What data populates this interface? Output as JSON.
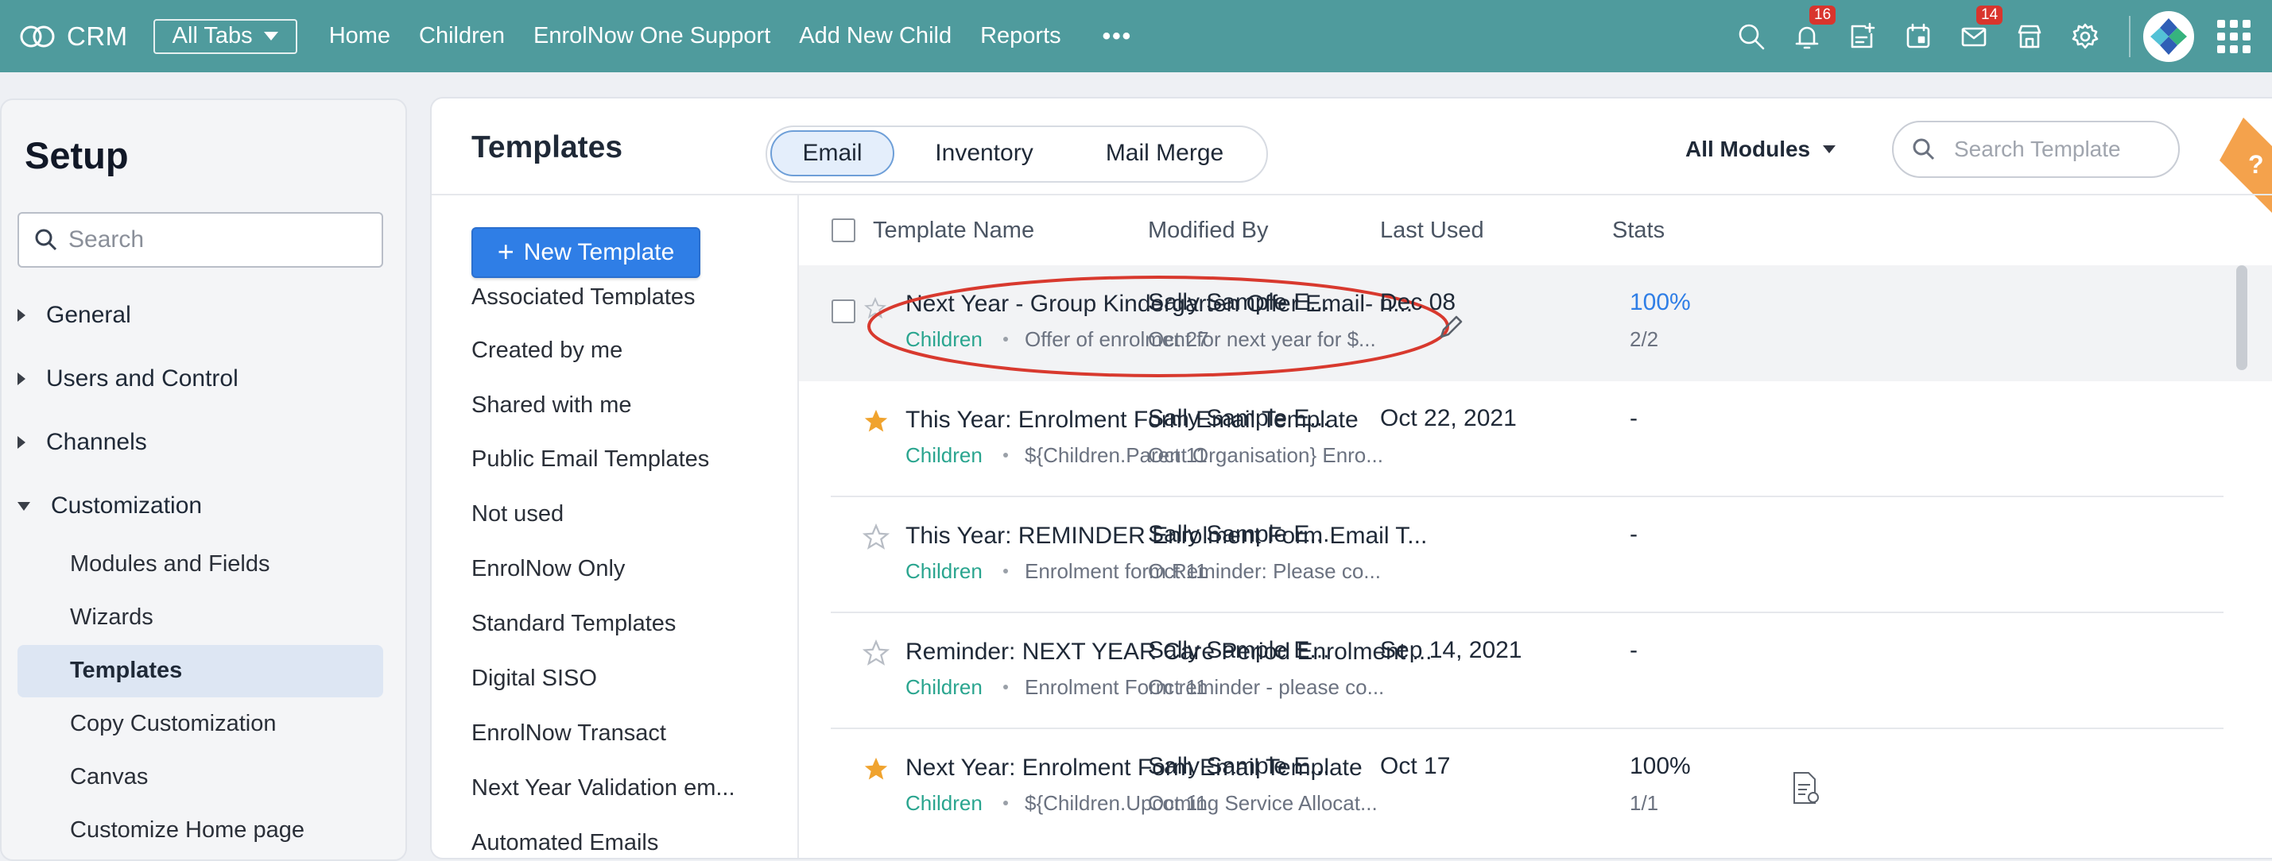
{
  "topbar": {
    "app_name": "CRM",
    "all_tabs_label": "All Tabs",
    "nav_items": [
      "Home",
      "Children",
      "EnrolNow One Support",
      "Add New Child",
      "Reports"
    ],
    "more_label": "•••",
    "icons": [
      "search-icon",
      "bell-icon",
      "add-note-icon",
      "calendar-icon",
      "mail-icon",
      "store-icon",
      "gear-icon"
    ],
    "badges": {
      "notifications": "16",
      "mail": "14"
    },
    "bar_color": "#4f9b9d"
  },
  "setup": {
    "title": "Setup",
    "search_placeholder": "Search",
    "sections": [
      {
        "label": "General",
        "expanded": false
      },
      {
        "label": "Users and Control",
        "expanded": false
      },
      {
        "label": "Channels",
        "expanded": false
      },
      {
        "label": "Customization",
        "expanded": true
      }
    ],
    "customization_items": [
      "Modules and Fields",
      "Wizards",
      "Templates",
      "Copy Customization",
      "Canvas",
      "Customize Home page"
    ],
    "active_item": "Templates"
  },
  "templates": {
    "title": "Templates",
    "tabs": [
      "Email",
      "Inventory",
      "Mail Merge"
    ],
    "active_tab": "Email",
    "module_filter": "All Modules",
    "search_placeholder": "Search Template",
    "help_label": "?",
    "new_template_label": "New Template",
    "filters": [
      "Associated Templates",
      "Created by me",
      "Shared with me",
      "Public Email Templates",
      "Not used",
      "EnrolNow Only",
      "Standard Templates",
      "Digital SISO",
      "EnrolNow Transact",
      "Next Year Validation em...",
      "Automated Emails"
    ],
    "columns": {
      "name": "Template Name",
      "modified_by": "Modified By",
      "last_used": "Last Used",
      "stats": "Stats"
    },
    "rows": [
      {
        "name": "Next Year - Group Kindergarten Offer Email- n...",
        "module": "Children",
        "desc": "Offer of enrolment for next year for $...",
        "modified_by": "Sally Sample E...",
        "modified_date": "Oct 27",
        "last_used": "Dec 08",
        "stat": "100%",
        "stat_sub": "2/2",
        "starred": false
      },
      {
        "name": "This Year: Enrolment Form Email Template",
        "module": "Children",
        "desc": "${Children.Parent Organisation} Enro...",
        "modified_by": "Sally Sample E...",
        "modified_date": "Oct 11",
        "last_used": "Oct 22, 2021",
        "stat": "-",
        "stat_sub": "",
        "starred": true
      },
      {
        "name": "This Year: REMINDER Enrolment Form Email T...",
        "module": "Children",
        "desc": "Enrolment form Reminder: Please co...",
        "modified_by": "Sally Sample E...",
        "modified_date": "Oct 11",
        "last_used": "",
        "stat": "-",
        "stat_sub": "",
        "starred": false
      },
      {
        "name": "Reminder: NEXT YEAR Care Period Enrolment ...",
        "module": "Children",
        "desc": "Enrolment Form reminder - please co...",
        "modified_by": "Sally Sample E...",
        "modified_date": "Oct 11",
        "last_used": "Sep 14, 2021",
        "stat": "-",
        "stat_sub": "",
        "starred": false
      },
      {
        "name": "Next Year: Enrolment Form Email Template",
        "module": "Children",
        "desc": "${Children.Upcoming Service Allocat...",
        "modified_by": "Sally Sample E...",
        "modified_date": "Oct 11",
        "last_used": "Oct 17",
        "stat": "100%",
        "stat_sub": "1/1",
        "starred": true
      }
    ]
  },
  "colors": {
    "accent": "#2f7ee6",
    "module_text": "#2aa58f",
    "star": "#f0a32e",
    "annotation": "#d8392e"
  }
}
